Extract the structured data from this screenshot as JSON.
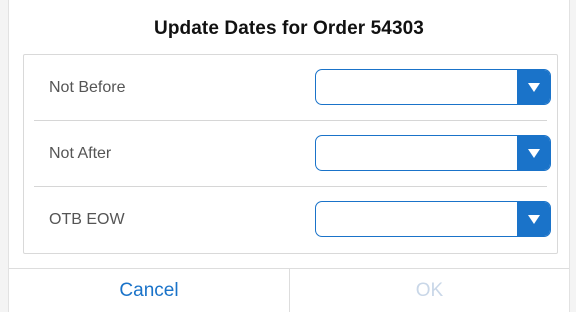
{
  "dialog": {
    "title": "Update Dates for Order 54303"
  },
  "fields": [
    {
      "label": "Not Before",
      "value": ""
    },
    {
      "label": "Not After",
      "value": ""
    },
    {
      "label": "OTB EOW",
      "value": ""
    }
  ],
  "footer": {
    "cancel_label": "Cancel",
    "ok_label": "OK",
    "ok_enabled": false
  },
  "icons": {
    "dropdown": "chevron-down-icon"
  },
  "colors": {
    "accent": "#1a73c9",
    "disabled": "#c9d7e8",
    "title": "#111111",
    "label": "#555555"
  }
}
